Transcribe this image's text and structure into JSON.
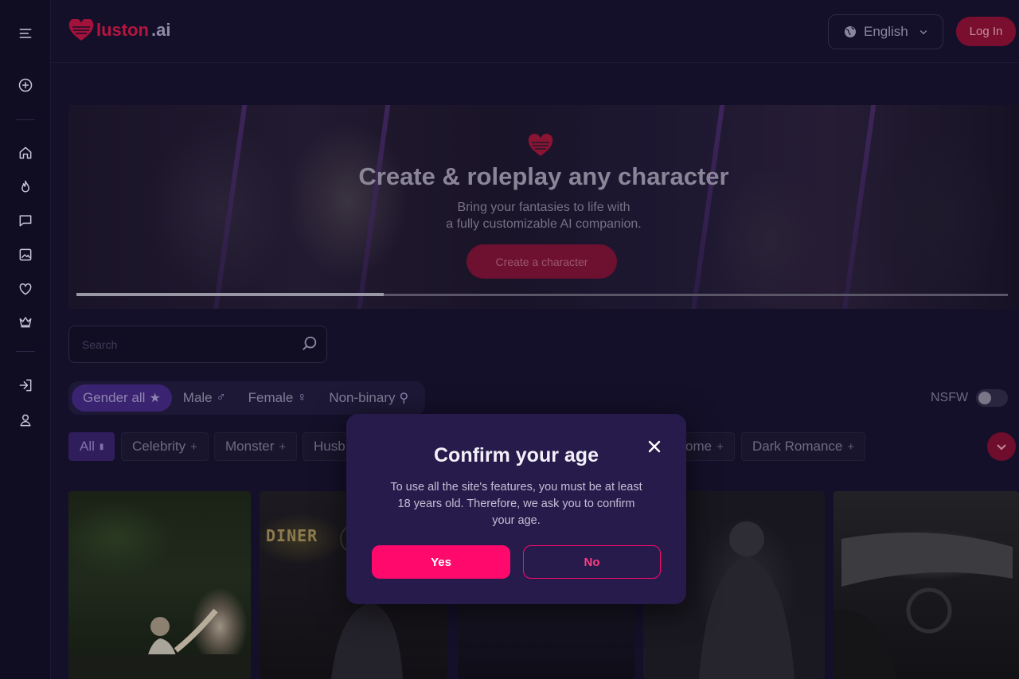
{
  "brand": {
    "name": "luston",
    "suffix": ".ai",
    "accent": "#ff0a6c",
    "dim_accent": "#7a0e2e"
  },
  "header": {
    "language": "English",
    "login_label": "Log In"
  },
  "sidebar": {
    "items": [
      {
        "icon": "menu-icon"
      },
      {
        "icon": "plus-circle-icon"
      },
      {
        "icon": "home-icon"
      },
      {
        "icon": "flame-icon"
      },
      {
        "icon": "chat-icon"
      },
      {
        "icon": "image-icon"
      },
      {
        "icon": "heart-icon"
      },
      {
        "icon": "crown-icon"
      },
      {
        "icon": "login-icon"
      },
      {
        "icon": "user-icon"
      }
    ]
  },
  "hero": {
    "title": "Create & roleplay any character",
    "subtitle_line1": "Bring your fantasies to life with",
    "subtitle_line2": "a fully customizable AI companion.",
    "cta_label": "Create a character",
    "progress": 0.33
  },
  "search": {
    "placeholder": "Search",
    "value": ""
  },
  "gender_filter": {
    "items": [
      {
        "label": "Gender all",
        "glyph": "★",
        "active": true
      },
      {
        "label": "Male",
        "glyph": "♂",
        "active": false
      },
      {
        "label": "Female",
        "glyph": "♀",
        "active": false
      },
      {
        "label": "Non-binary",
        "glyph": "⚲",
        "active": false
      }
    ]
  },
  "nsfw": {
    "label": "NSFW",
    "enabled": false
  },
  "categories": {
    "items": [
      {
        "label": "All",
        "suffix": "▮",
        "active": true
      },
      {
        "label": "Celebrity",
        "suffix": "+"
      },
      {
        "label": "Monster",
        "suffix": "+"
      },
      {
        "label": "Husb",
        "suffix": ""
      },
      {
        "label": "ome",
        "suffix": "+"
      },
      {
        "label": "Dark Romance",
        "suffix": "+"
      }
    ]
  },
  "cards": {
    "sign_text": "DINER"
  },
  "modal": {
    "title": "Confirm your age",
    "text": "To use all the site's features, you must be at least 18 years old. Therefore, we ask you to confirm your age.",
    "yes_label": "Yes",
    "no_label": "No"
  }
}
